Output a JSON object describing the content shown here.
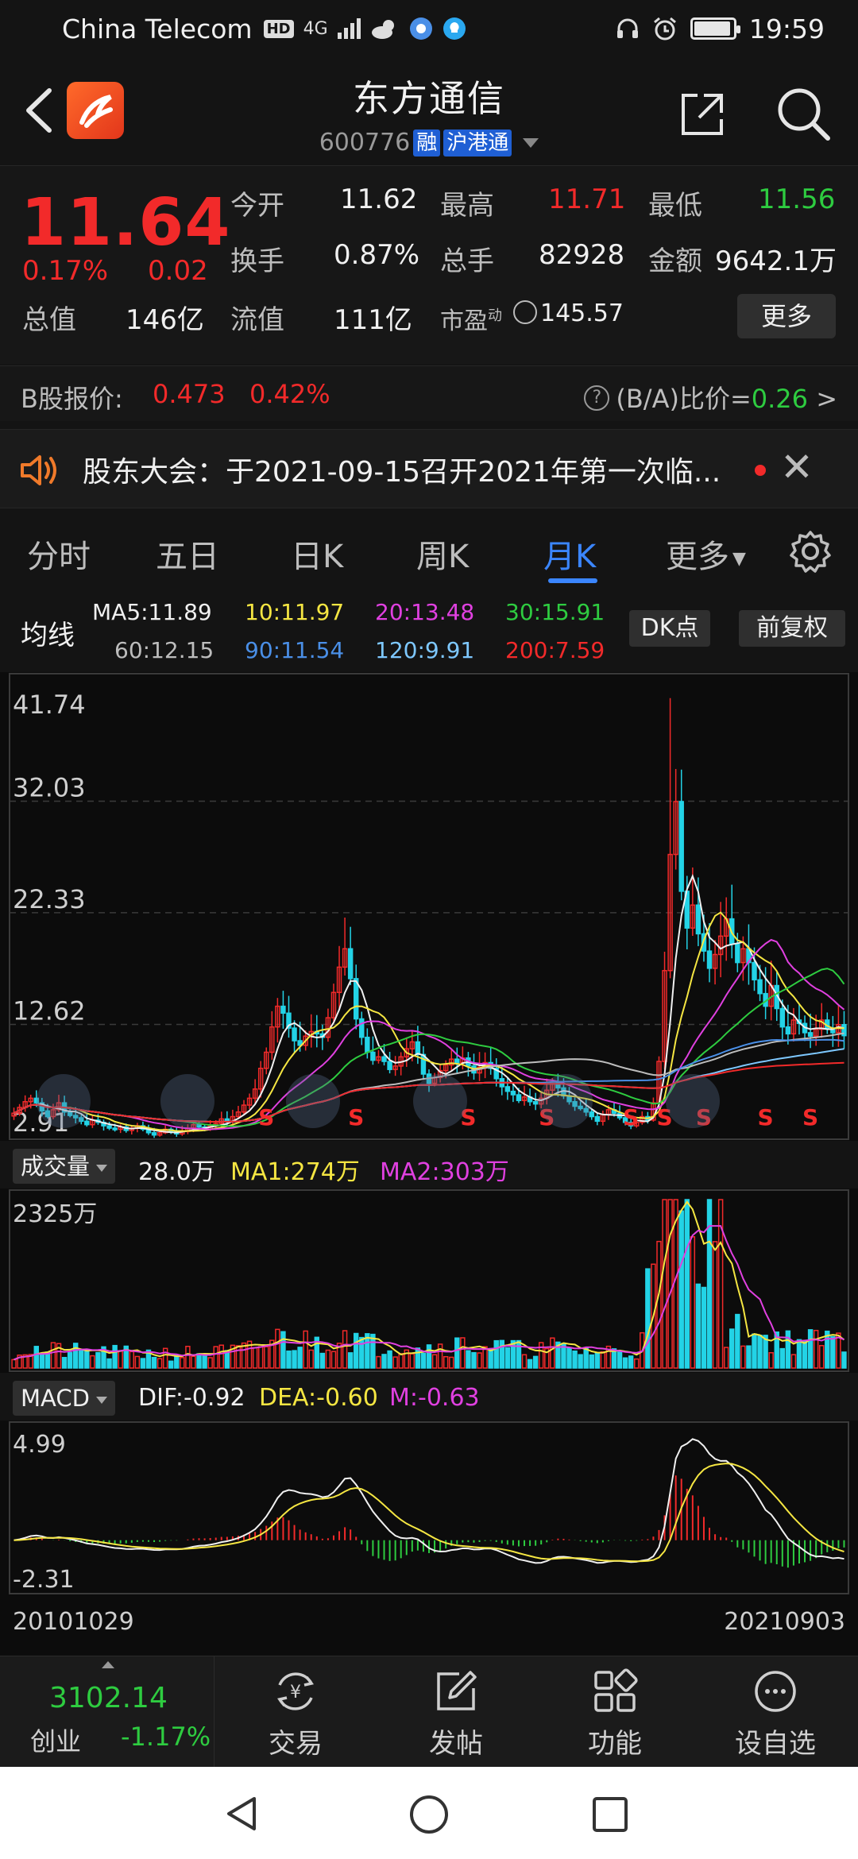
{
  "status_bar": {
    "carrier": "China Telecom",
    "hd": "HD",
    "network": "4G",
    "time": "19:59"
  },
  "header": {
    "title": "东方通信",
    "code": "600776",
    "badges": [
      "融",
      "沪港通"
    ]
  },
  "quote": {
    "price": "11.64",
    "change_pct": "0.17%",
    "change_val": "0.02",
    "open_label": "今开",
    "open": "11.62",
    "high_label": "最高",
    "high": "11.71",
    "low_label": "最低",
    "low": "11.56",
    "turnover_label": "换手",
    "turnover": "0.87%",
    "volume_label": "总手",
    "volume": "82928",
    "amount_label": "金额",
    "amount": "9642.1万",
    "total_value_label": "总值",
    "total_value": "146亿",
    "float_value_label": "流值",
    "float_value": "111亿",
    "pe_label": "市盈",
    "pe_sup": "动",
    "pe": "145.57",
    "more_label": "更多"
  },
  "b_share": {
    "label": "B股报价:",
    "price": "0.473",
    "pct": "0.42%",
    "ratio_label": "(B/A)比价=",
    "ratio": "0.26",
    "arrow": ">"
  },
  "notice": {
    "text": "股东大会：于2021-09-15召开2021年第一次临..."
  },
  "tabs": [
    {
      "label": "分时"
    },
    {
      "label": "五日"
    },
    {
      "label": "日K"
    },
    {
      "label": "周K"
    },
    {
      "label": "月K"
    },
    {
      "label": "更多"
    }
  ],
  "ma": {
    "title": "均线",
    "items": [
      {
        "text": "MA5:11.89",
        "color": "#f0f0f0"
      },
      {
        "text": "10:11.97",
        "color": "#f5e642"
      },
      {
        "text": "20:13.48",
        "color": "#e040e0"
      },
      {
        "text": "30:15.91",
        "color": "#2ecc40"
      },
      {
        "text": "60:12.15",
        "color": "#bdbdbd"
      },
      {
        "text": "90:11.54",
        "color": "#4a8fe7"
      },
      {
        "text": "120:9.91",
        "color": "#7ec8ff"
      },
      {
        "text": "200:7.59",
        "color": "#f22a2a"
      }
    ],
    "dk_label": "DK点",
    "fq_label": "前复权"
  },
  "chart_data": [
    {
      "type": "candlestick",
      "period": "monthly",
      "y_ticks": [
        "41.74",
        "32.03",
        "22.33",
        "12.62",
        "2.91"
      ],
      "ylim": [
        2.91,
        41.74
      ],
      "x_range": [
        "20101029",
        "20210903"
      ],
      "close": [
        4.9,
        5.4,
        5.9,
        6.2,
        5.8,
        5.1,
        4.6,
        5.2,
        5.8,
        5.0,
        4.7,
        4.5,
        4.2,
        3.9,
        4.3,
        4.1,
        3.8,
        3.6,
        3.5,
        3.7,
        3.4,
        3.6,
        3.8,
        3.5,
        3.2,
        3.0,
        3.2,
        3.5,
        3.3,
        3.1,
        3.3,
        3.6,
        3.9,
        3.7,
        3.5,
        3.8,
        4.0,
        4.4,
        4.2,
        4.6,
        5.0,
        5.6,
        6.2,
        7.0,
        8.8,
        10.2,
        12.4,
        14.2,
        13.6,
        12.3,
        11.2,
        10.8,
        11.6,
        12.0,
        11.8,
        11.5,
        13.2,
        15.4,
        17.6,
        19.2,
        16.6,
        13.1,
        11.5,
        10.2,
        9.5,
        9.8,
        9.4,
        8.7,
        9.0,
        9.8,
        10.5,
        11.1,
        10.0,
        8.3,
        7.5,
        8.0,
        8.6,
        9.1,
        9.6,
        9.3,
        9.7,
        9.0,
        8.4,
        8.9,
        9.3,
        8.8,
        7.9,
        7.2,
        6.8,
        6.5,
        6.0,
        6.3,
        5.9,
        5.7,
        6.2,
        6.9,
        7.6,
        7.1,
        6.4,
        5.9,
        5.5,
        5.3,
        5.0,
        4.6,
        4.2,
        4.8,
        5.2,
        4.9,
        4.5,
        4.1,
        3.8,
        4.1,
        4.6,
        4.3,
        5.8,
        9.4,
        17.3,
        27.4,
        32.0,
        24.2,
        21.0,
        23.0,
        20.5,
        19.0,
        17.5,
        18.7,
        20.3,
        21.8,
        19.6,
        18.0,
        19.2,
        18.0,
        16.5,
        15.3,
        14.2,
        16.0,
        14.0,
        12.4,
        11.8,
        13.0,
        12.7,
        11.9,
        11.6,
        12.2,
        13.0,
        12.3,
        11.9,
        12.6,
        11.64
      ],
      "ma_series": [
        {
          "text": "MA5:11.89",
          "color": "#f0f0f0"
        },
        {
          "text": "10:11.97",
          "color": "#f5e642"
        },
        {
          "text": "20:13.48",
          "color": "#e040e0"
        },
        {
          "text": "30:15.91",
          "color": "#2ecc40"
        },
        {
          "text": "60:12.15",
          "color": "#bdbdbd"
        },
        {
          "text": "90:11.54",
          "color": "#4a8fe7"
        },
        {
          "text": "120:9.91",
          "color": "#7ec8ff"
        },
        {
          "text": "200:7.59",
          "color": "#f22a2a"
        }
      ],
      "marker_label": "S"
    },
    {
      "type": "bar",
      "name": "volume",
      "y_ticks": [
        "2325万"
      ],
      "ylim": [
        0,
        2325
      ],
      "current_label": "28.0万",
      "series": [
        {
          "name": "MA1:274万",
          "color": "#f5e642"
        },
        {
          "name": "MA2:303万",
          "color": "#e040e0"
        }
      ]
    },
    {
      "type": "bar",
      "name": "MACD",
      "y_ticks": [
        "4.99",
        "-2.31"
      ],
      "ylim": [
        -2.31,
        4.99
      ],
      "series": [
        {
          "name": "DIF:-0.92",
          "color": "#f0f0f0"
        },
        {
          "name": "DEA:-0.60",
          "color": "#f5e642"
        },
        {
          "name": "M:-0.63",
          "color": "#e040e0"
        }
      ]
    }
  ],
  "vol_panel": {
    "selector": "成交量",
    "current": "28.0万",
    "ma1": "MA1:274万",
    "ma2": "MA2:303万"
  },
  "macd_panel": {
    "selector": "MACD",
    "dif": "DIF:-0.92",
    "dea": "DEA:-0.60",
    "m": "M:-0.63"
  },
  "dates": {
    "start": "20101029",
    "end": "20210903"
  },
  "bottom_nav": {
    "index_value": "3102.14",
    "index_name": "创业",
    "index_pct": "-1.17%",
    "items": [
      {
        "label": "交易"
      },
      {
        "label": "发帖"
      },
      {
        "label": "功能"
      },
      {
        "label": "设自选"
      }
    ]
  }
}
